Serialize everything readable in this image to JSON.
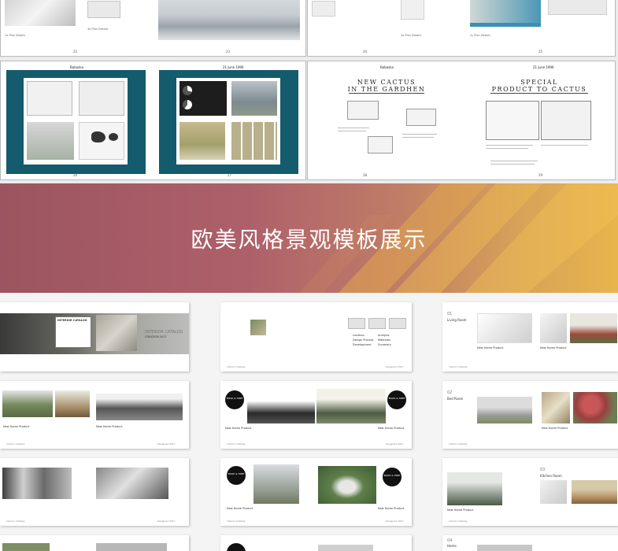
{
  "top": {
    "spreads": [
      {
        "left_page_number": "22",
        "right_page_number": "23",
        "captions": [
          "2a Plan Details",
          "3b Plan Details",
          "2a Plan Details",
          "2c Plan Details"
        ]
      },
      {
        "left_page_number": "24",
        "right_page_number": "25"
      }
    ],
    "teal_spread": {
      "left_header": "Babaska",
      "right_header": "21 June 1996",
      "left_page_number": "26",
      "right_page_number": "27"
    },
    "cactus_spread": {
      "left_header": "Babaska",
      "right_header": "21 June 1996",
      "left_title_line1": "NEW CACTUS",
      "left_title_line2": "IN THE GARDHEN",
      "right_title_line1": "SPECIAL",
      "right_title_line2": "PRODUCT TO CACTUS",
      "left_page_number": "28",
      "right_page_number": "29"
    }
  },
  "banner": {
    "title": "欧美风格景观模板展示",
    "colors": {
      "start": "#9c5560",
      "end": "#e8b44c"
    }
  },
  "grid": {
    "cover": {
      "name_label": "INTERIOR CATALOG",
      "sub_label": "CREATION 2017",
      "box_title": "INTERIOR CATALOG"
    },
    "content_card": {
      "list_items": [
        "Location",
        "Design Process",
        "Development",
        "Analysis",
        "Materials",
        "Summary"
      ]
    },
    "rooms": [
      {
        "number": "01",
        "name": "Living Room"
      },
      {
        "number": "02",
        "name": "Bed Room"
      },
      {
        "number": "03",
        "name": "Kitchen Room"
      },
      {
        "number": "04",
        "name": "Home"
      }
    ],
    "product_label": "New Home Product",
    "badge_text": "BOOK & TREE",
    "footer_left": "Interior Catalog",
    "footer_right": "Designed 2017"
  }
}
